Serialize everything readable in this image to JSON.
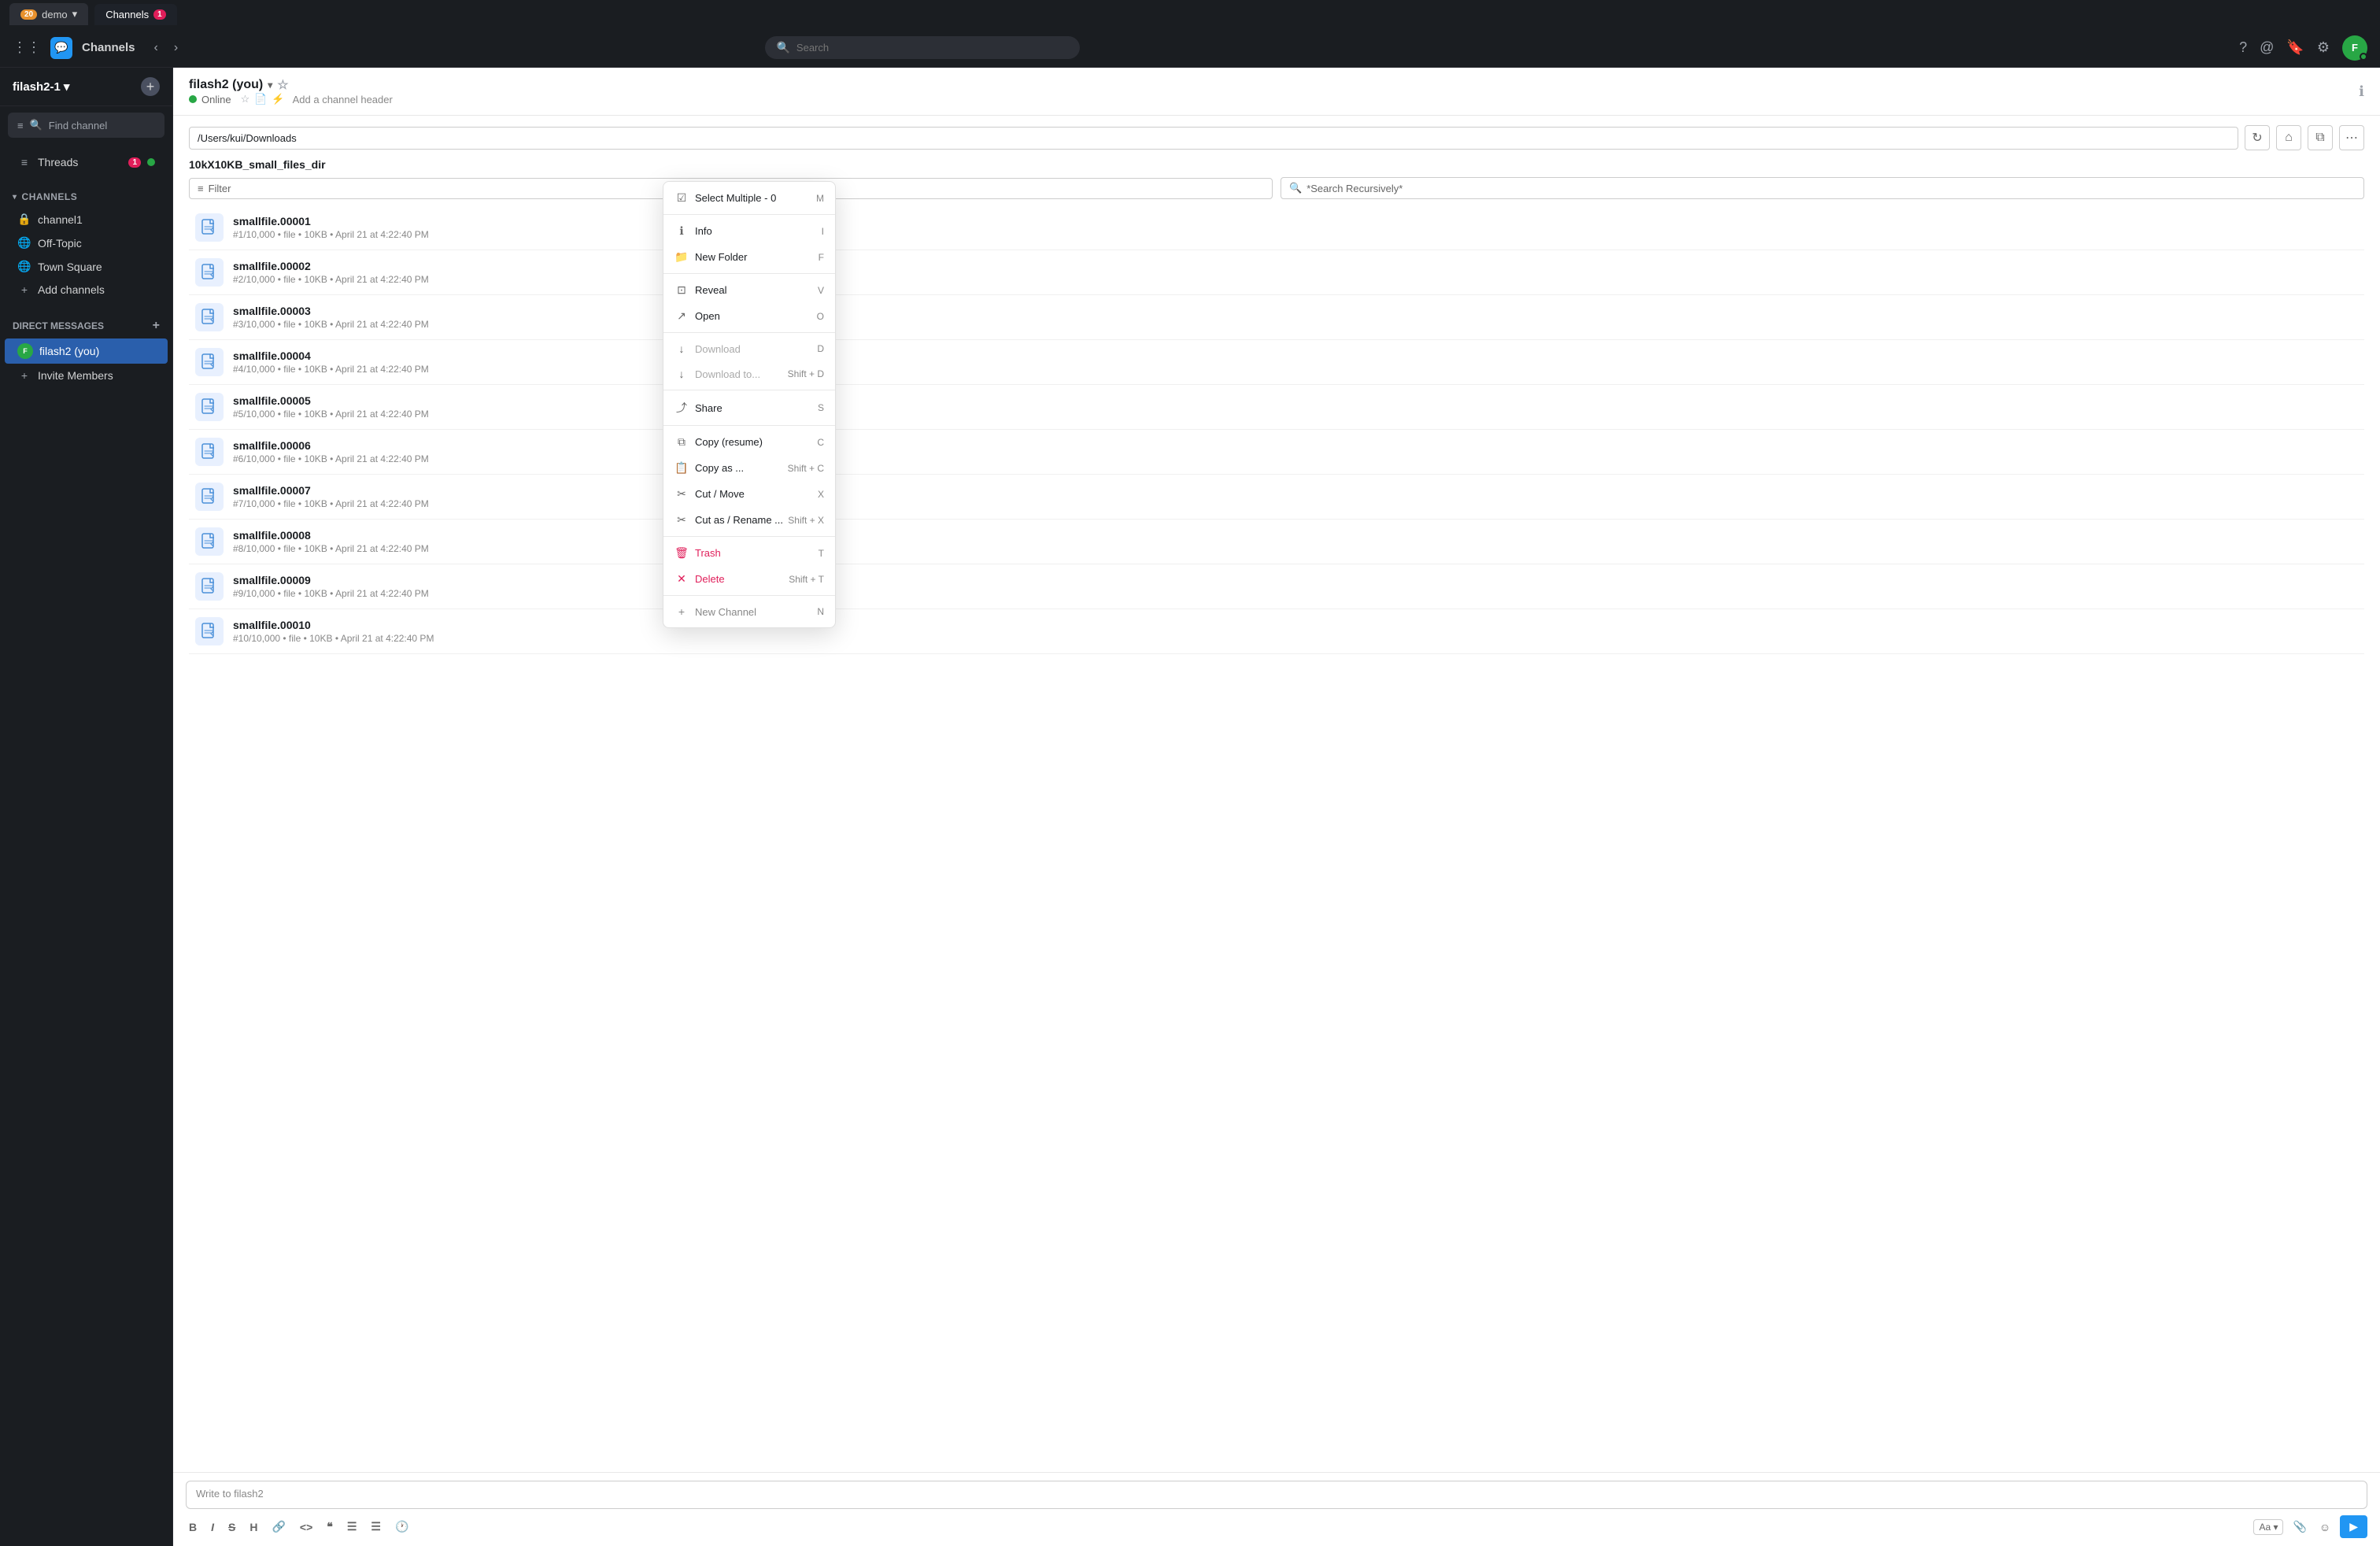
{
  "os_bar": {
    "tabs": [
      {
        "label": "demo",
        "badge": "20",
        "badge_type": "red",
        "active": false
      },
      {
        "label": "Channels",
        "badge": "1",
        "badge_type": "normal",
        "active": true
      }
    ]
  },
  "toolbar": {
    "app_icon": "💬",
    "title": "Channels",
    "search_placeholder": "Search",
    "help_icon": "?",
    "mention_icon": "@",
    "bookmark_icon": "🔖",
    "settings_icon": "⚙",
    "avatar_initials": "F",
    "nav_back": "‹",
    "nav_forward": "›",
    "grid_icon": "⋮⋮⋮"
  },
  "sidebar": {
    "workspace": "filash2-1",
    "workspace_chevron": "▾",
    "find_channel_placeholder": "Find channel",
    "sections": {
      "threads_label": "Threads",
      "threads_badge": "1",
      "channels_label": "CHANNELS",
      "channels_chevron": "▾",
      "channels": [
        {
          "icon": "🔒",
          "label": "channel1"
        },
        {
          "icon": "🌐",
          "label": "Off-Topic"
        },
        {
          "icon": "🌐",
          "label": "Town Square"
        }
      ],
      "add_channels_label": "Add channels",
      "dm_label": "DIRECT MESSAGES",
      "dms": [
        {
          "label": "filash2 (you)",
          "initials": "F",
          "active": true
        }
      ],
      "invite_label": "Invite Members"
    }
  },
  "channel_header": {
    "name": "filash2 (you)",
    "chevron": "▾",
    "star_icon": "☆",
    "online_status": "Online",
    "sub_icons": [
      "📄",
      "⚡"
    ],
    "header_placeholder": "Add a channel header",
    "info_icon": "ℹ"
  },
  "file_browser": {
    "path": "/Users/kui/Downloads",
    "refresh_icon": "↻",
    "home_icon": "⌂",
    "copy_icon": "⧉",
    "more_icon": "⋯",
    "dir_name": "10kX10KB_small_files_dir",
    "filter_placeholder": "Filter",
    "search_placeholder": "*Search Recursively*",
    "files": [
      {
        "name": "smallfile.00001",
        "meta": "#1/10,000  •  file  •  10KB  •  April 21 at 4:22:40 PM"
      },
      {
        "name": "smallfile.00002",
        "meta": "#2/10,000  •  file  •  10KB  •  April 21 at 4:22:40 PM"
      },
      {
        "name": "smallfile.00003",
        "meta": "#3/10,000  •  file  •  10KB  •  April 21 at 4:22:40 PM"
      },
      {
        "name": "smallfile.00004",
        "meta": "#4/10,000  •  file  •  10KB  •  April 21 at 4:22:40 PM"
      },
      {
        "name": "smallfile.00005",
        "meta": "#5/10,000  •  file  •  10KB  •  April 21 at 4:22:40 PM"
      },
      {
        "name": "smallfile.00006",
        "meta": "#6/10,000  •  file  •  10KB  •  April 21 at 4:22:40 PM"
      },
      {
        "name": "smallfile.00007",
        "meta": "#7/10,000  •  file  •  10KB  •  April 21 at 4:22:40 PM"
      },
      {
        "name": "smallfile.00008",
        "meta": "#8/10,000  •  file  •  10KB  •  April 21 at 4:22:40 PM"
      },
      {
        "name": "smallfile.00009",
        "meta": "#9/10,000  •  file  •  10KB  •  April 21 at 4:22:40 PM"
      },
      {
        "name": "smallfile.00010",
        "meta": "#10/10,000  •  file  •  10KB  •  April 21 at 4:22:40 PM"
      }
    ]
  },
  "message_input": {
    "placeholder": "Write to filash2",
    "toolbar": {
      "bold": "B",
      "italic": "I",
      "strikethrough": "S",
      "heading": "H",
      "link": "🔗",
      "code": "<>",
      "blockquote": "❝",
      "ul": "☰",
      "ol": "☰",
      "emoji_time": "🕐",
      "font_size": "Aa",
      "attachment": "📎",
      "emoji": "☺",
      "send": "▶"
    }
  },
  "context_menu": {
    "items": [
      {
        "icon": "☑",
        "label": "Select Multiple - 0",
        "shortcut": "M",
        "disabled": false,
        "type": "normal"
      },
      {
        "divider": true
      },
      {
        "icon": "ℹ",
        "label": "Info",
        "shortcut": "I",
        "disabled": false,
        "type": "normal"
      },
      {
        "icon": "📁",
        "label": "New Folder",
        "shortcut": "F",
        "disabled": false,
        "type": "normal"
      },
      {
        "divider": true
      },
      {
        "icon": "⊡",
        "label": "Reveal",
        "shortcut": "V",
        "disabled": false,
        "type": "normal"
      },
      {
        "icon": "↗",
        "label": "Open",
        "shortcut": "O",
        "disabled": false,
        "type": "normal"
      },
      {
        "divider": true
      },
      {
        "icon": "↓",
        "label": "Download",
        "shortcut": "D",
        "disabled": true,
        "type": "normal"
      },
      {
        "icon": "↓",
        "label": "Download to...",
        "shortcut": "Shift + D",
        "disabled": true,
        "type": "normal"
      },
      {
        "divider": true
      },
      {
        "icon": "⤴",
        "label": "Share",
        "shortcut": "S",
        "disabled": false,
        "type": "normal"
      },
      {
        "divider": true
      },
      {
        "icon": "⧉",
        "label": "Copy (resume)",
        "shortcut": "C",
        "disabled": false,
        "type": "normal"
      },
      {
        "icon": "📋",
        "label": "Copy as ...",
        "shortcut": "Shift + C",
        "disabled": false,
        "type": "normal"
      },
      {
        "icon": "✂",
        "label": "Cut / Move",
        "shortcut": "X",
        "disabled": false,
        "type": "normal"
      },
      {
        "icon": "✂",
        "label": "Cut as / Rename ...",
        "shortcut": "Shift + X",
        "disabled": false,
        "type": "normal"
      },
      {
        "divider": true
      },
      {
        "icon": "🗑",
        "label": "Trash",
        "shortcut": "T",
        "disabled": false,
        "type": "danger"
      },
      {
        "icon": "✕",
        "label": "Delete",
        "shortcut": "Shift + T",
        "disabled": false,
        "type": "danger-delete"
      },
      {
        "divider": true
      },
      {
        "icon": "+",
        "label": "New Channel",
        "shortcut": "N",
        "disabled": false,
        "type": "new-channel"
      }
    ]
  }
}
